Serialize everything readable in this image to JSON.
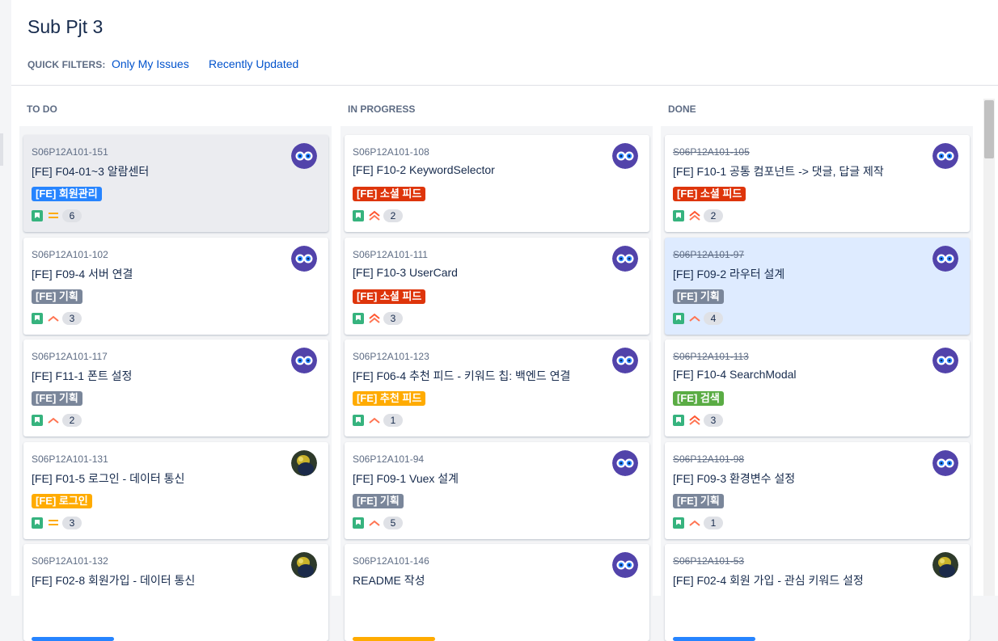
{
  "project": {
    "title": "Sub Pjt 3"
  },
  "quick_filters": {
    "label": "QUICK FILTERS:",
    "items": [
      "Only My Issues",
      "Recently Updated"
    ]
  },
  "colors": {
    "story": "#36b37e",
    "epic_member": "#2684ff",
    "epic_social": "#de350b",
    "epic_plan": "#7a869a",
    "epic_recommend": "#ffab00",
    "epic_login": "#ffab00",
    "epic_search": "#5aac44",
    "prio_medium": "#ffab00",
    "prio_high": "#ff7452",
    "prio_highest": "#ff5630",
    "link": "#0052cc"
  },
  "columns": [
    {
      "title": "TO DO",
      "cards": [
        {
          "key": "S06P12A101-151",
          "summary": "[FE] F04-01~3 알람센터",
          "epic": "[FE] 회원관리",
          "epic_color": "#2684ff",
          "priority": "medium",
          "points": "6",
          "avatar": "owl-icon",
          "state": "gray"
        },
        {
          "key": "S06P12A101-102",
          "summary": "[FE] F09-4 서버 연결",
          "epic": "[FE] 기획",
          "epic_color": "#7a869a",
          "priority": "high",
          "points": "3",
          "avatar": "owl-icon",
          "state": ""
        },
        {
          "key": "S06P12A101-117",
          "summary": "[FE] F11-1 폰트 설정",
          "epic": "[FE] 기획",
          "epic_color": "#7a869a",
          "priority": "high",
          "points": "2",
          "avatar": "owl-icon",
          "state": ""
        },
        {
          "key": "S06P12A101-131",
          "summary": "[FE] F01-5 로그인 - 데이터 통신",
          "epic": "[FE] 로그인",
          "epic_color": "#ffab00",
          "priority": "medium",
          "points": "3",
          "avatar": "photo-avatar",
          "state": ""
        },
        {
          "key": "S06P12A101-132",
          "summary": "[FE] F02-8 회원가입 - 데이터 통신",
          "epic": "",
          "epic_color": "#2684ff",
          "priority": "medium",
          "points": "",
          "avatar": "photo-avatar",
          "state": ""
        }
      ]
    },
    {
      "title": "IN PROGRESS",
      "cards": [
        {
          "key": "S06P12A101-108",
          "summary": "[FE] F10-2 KeywordSelector",
          "epic": "[FE] 소셜 피드",
          "epic_color": "#de350b",
          "priority": "highest",
          "points": "2",
          "avatar": "owl-icon",
          "state": ""
        },
        {
          "key": "S06P12A101-111",
          "summary": "[FE] F10-3 UserCard",
          "epic": "[FE] 소셜 피드",
          "epic_color": "#de350b",
          "priority": "highest",
          "points": "3",
          "avatar": "owl-icon",
          "state": ""
        },
        {
          "key": "S06P12A101-123",
          "summary": "[FE] F06-4 추천 피드 - 키워드 칩: 백엔드 연결",
          "epic": "[FE] 추천 피드",
          "epic_color": "#ffab00",
          "priority": "high",
          "points": "1",
          "avatar": "owl-icon",
          "state": ""
        },
        {
          "key": "S06P12A101-94",
          "summary": "[FE] F09-1 Vuex 설계",
          "epic": "[FE] 기획",
          "epic_color": "#7a869a",
          "priority": "high",
          "points": "5",
          "avatar": "owl-icon",
          "state": ""
        },
        {
          "key": "S06P12A101-146",
          "summary": "README 작성",
          "epic": "",
          "epic_color": "#ffab00",
          "priority": "medium",
          "points": "",
          "avatar": "owl-icon",
          "state": ""
        }
      ]
    },
    {
      "title": "DONE",
      "cards": [
        {
          "key": "S06P12A101-105",
          "summary": "[FE] F10-1 공통 컴포넌트 -> 댓글, 답글 제작",
          "epic": "[FE] 소셜 피드",
          "epic_color": "#de350b",
          "priority": "highest",
          "points": "2",
          "avatar": "owl-icon",
          "state": ""
        },
        {
          "key": "S06P12A101-97",
          "summary": "[FE] F09-2 라우터 설계",
          "epic": "[FE] 기획",
          "epic_color": "#7a869a",
          "priority": "high",
          "points": "4",
          "avatar": "owl-icon",
          "state": "selected"
        },
        {
          "key": "S06P12A101-113",
          "summary": "[FE] F10-4 SearchModal",
          "epic": "[FE] 검색",
          "epic_color": "#5aac44",
          "priority": "highest",
          "points": "3",
          "avatar": "owl-icon",
          "state": ""
        },
        {
          "key": "S06P12A101-98",
          "summary": "[FE] F09-3 환경변수 설정",
          "epic": "[FE] 기획",
          "epic_color": "#7a869a",
          "priority": "high",
          "points": "1",
          "avatar": "owl-icon",
          "state": ""
        },
        {
          "key": "S06P12A101-53",
          "summary": "[FE] F02-4 회원 가입 - 관심 키워드 설정",
          "epic": "",
          "epic_color": "#2684ff",
          "priority": "medium",
          "points": "",
          "avatar": "photo-avatar",
          "state": ""
        }
      ]
    }
  ]
}
